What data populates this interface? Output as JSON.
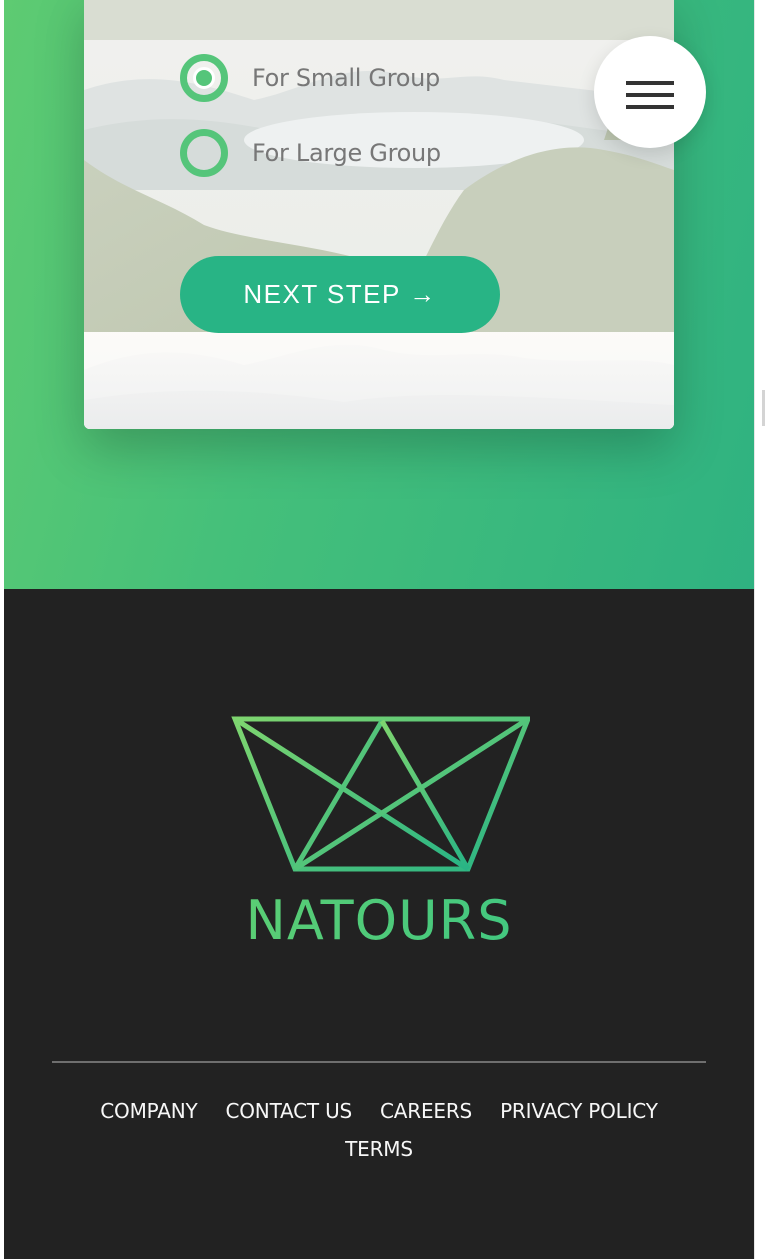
{
  "booking": {
    "options": [
      {
        "label": "For Small Group",
        "selected": true
      },
      {
        "label": "For Large Group",
        "selected": false
      }
    ],
    "next_button_label": "NEXT STEP →"
  },
  "menu": {
    "icon": "hamburger-icon"
  },
  "footer": {
    "brand": "NATOURS",
    "logo_icon": "crown-logo-icon",
    "links": [
      "COMPANY",
      "CONTACT US",
      "CAREERS",
      "PRIVACY POLICY",
      "TERMS"
    ]
  },
  "colors": {
    "primary_green": "#55c57a",
    "button_green": "#28b485",
    "footer_bg": "#222222",
    "footer_text": "#f7f7f7"
  }
}
